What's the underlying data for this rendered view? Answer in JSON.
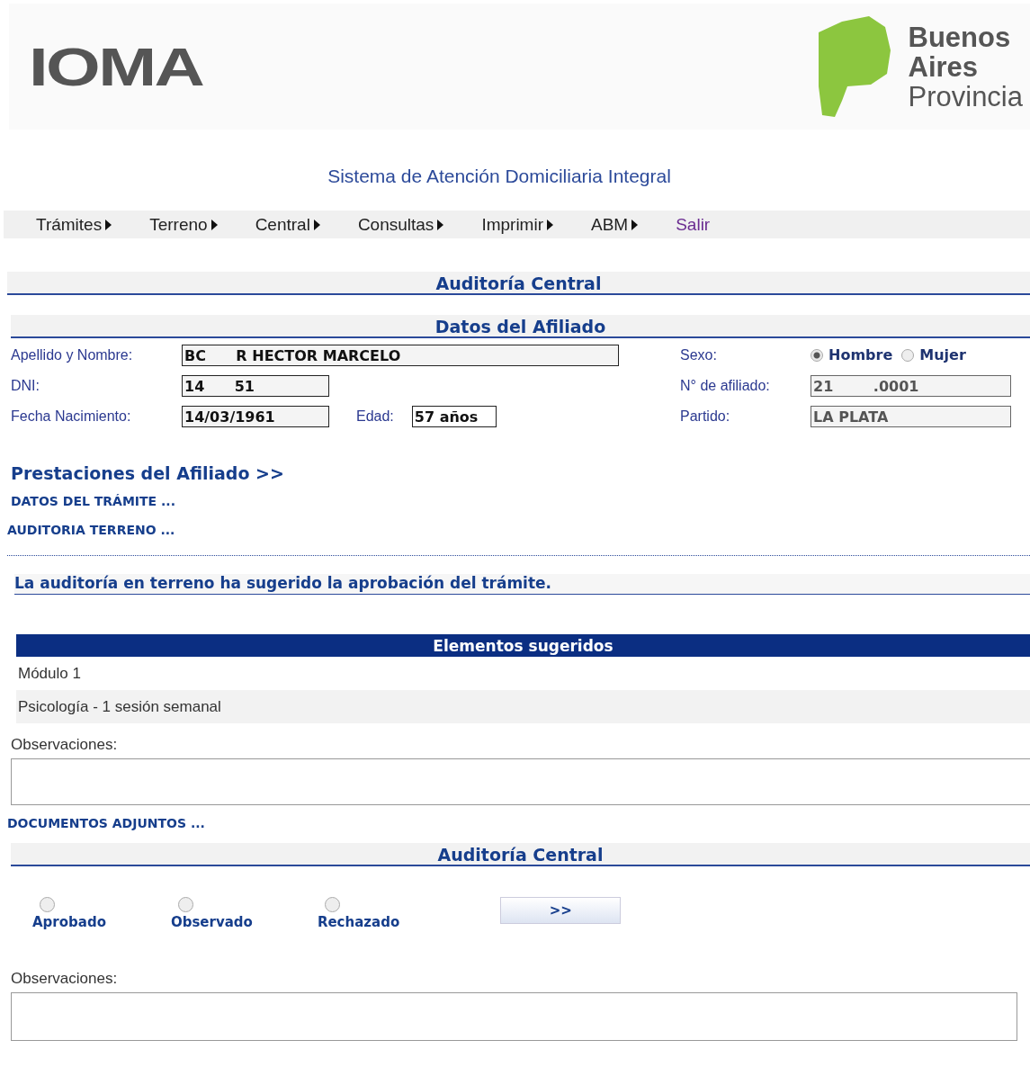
{
  "header": {
    "logo": "IOMA",
    "province_logo": [
      "Buenos",
      "Aires",
      "Provincia"
    ]
  },
  "system_title": "Sistema de Atención Domiciliaria Integral",
  "menu": [
    {
      "label": "Trámites",
      "kind": "submenu"
    },
    {
      "label": "Terreno",
      "kind": "submenu"
    },
    {
      "label": "Central",
      "kind": "submenu"
    },
    {
      "label": "Consultas",
      "kind": "submenu"
    },
    {
      "label": "Imprimir",
      "kind": "submenu"
    },
    {
      "label": "ABM",
      "kind": "submenu"
    },
    {
      "label": "Salir",
      "kind": "link"
    }
  ],
  "page_title": "Auditoría Central",
  "affiliate": {
    "title": "Datos del Afiliado",
    "name_label": "Apellido y Nombre:",
    "name": "BC      R HECTOR MARCELO",
    "dni_label": "DNI:",
    "dni": "14      51",
    "birth_label": "Fecha Nacimiento:",
    "birth": "14/03/1961",
    "age_label": "Edad:",
    "age": "57 años",
    "sex_label": "Sexo:",
    "sex_options": [
      {
        "label": "Hombre",
        "selected": true
      },
      {
        "label": "Mujer",
        "selected": false
      }
    ],
    "member_label": "N° de afiliado:",
    "member": "21        .0001",
    "district_label": "Partido:",
    "district": "LA PLATA"
  },
  "benefits_link": "Prestaciones del Afiliado >>",
  "procedure_link": "DATOS DEL TRÁMITE ...",
  "field_audit_link": "AUDITORIA TERRENO ...",
  "field_audit_message": "La auditoría en terreno ha sugerido la aprobación del trámite.",
  "suggested": {
    "title": "Elementos sugeridos",
    "rows": [
      "Módulo 1",
      "Psicología - 1 sesión semanal"
    ]
  },
  "observations_label": "Observaciones:",
  "documents_link": "DOCUMENTOS ADJUNTOS ...",
  "central_audit": {
    "title": "Auditoría Central",
    "options": [
      {
        "label": "Aprobado",
        "selected": false
      },
      {
        "label": "Observado",
        "selected": false
      },
      {
        "label": "Rechazado",
        "selected": false
      }
    ],
    "button": ">>",
    "observations_label": "Observaciones:"
  }
}
